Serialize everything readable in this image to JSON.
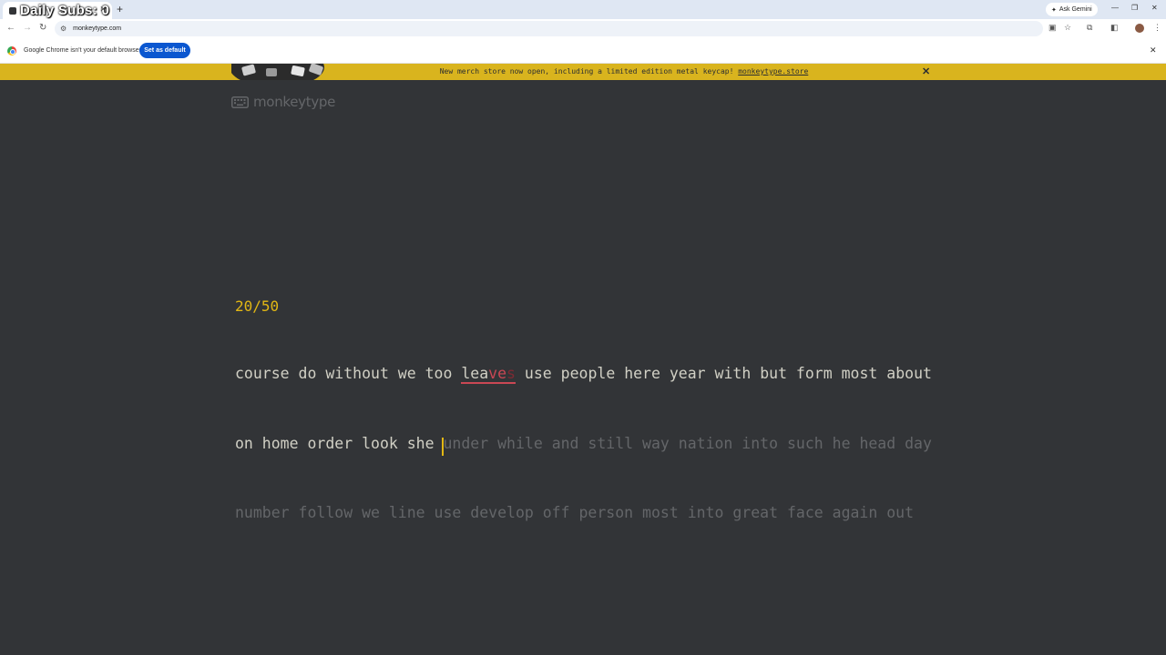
{
  "browser": {
    "tab_title": "Daily Subs: 0",
    "url": "monkeytype.com",
    "gemini_label": "Ask Gemini",
    "infobar_text": "Google Chrome isn't your default browser",
    "set_default_label": "Set as default"
  },
  "banner": {
    "text": "New merch store now open, including a limited edition metal keycap!",
    "link": "monkeytype.store"
  },
  "header": {
    "logo_text": "monkeytype"
  },
  "test": {
    "counter": "20/50",
    "line1_typed_a": "course do without we too",
    "error_correct": "lea",
    "error_wrong": "ve",
    "error_extra": "s",
    "line1_typed_b": "use people here year with but form most about",
    "line2_typed": "on home order look she",
    "caret_char": "u",
    "line2_rest": "nder while and still way nation into such he head day",
    "line3": "number follow we line use develop off person most into great face again out"
  },
  "colors": {
    "background": "#323437",
    "banner": "#d9b41e",
    "main": "#e2b714",
    "text": "#d1d0c5",
    "sub": "#646669",
    "error": "#ca4754"
  }
}
